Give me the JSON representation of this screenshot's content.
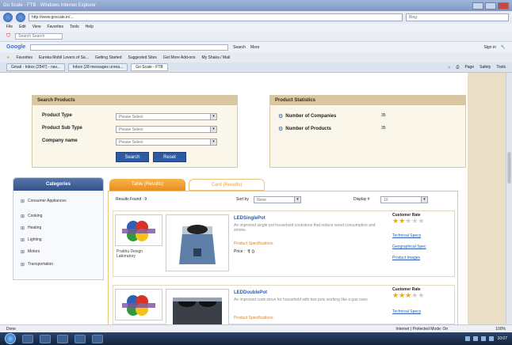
{
  "browser": {
    "title": "Go Scale - FTB - Windows Internet Explorer",
    "url": "http://www.goscale.in/...",
    "search_placeholder": "Bing",
    "menu": [
      "File",
      "Edit",
      "View",
      "Favorites",
      "Tools",
      "Help"
    ],
    "toolbar_search_placeholder": "Search Search",
    "google_label": "Google",
    "google_search_btn": "Search",
    "google_more": "More",
    "google_right": "Sign in",
    "favorites_label": "Favorites",
    "favorites": [
      "Eureka Mobil Lovers of Sa...",
      "Getting Started",
      "Suggested Sites",
      "Get More Add-ons",
      "My Shaka / Mail"
    ],
    "tabs": [
      {
        "label": "Gmail - Inbox (2547) - nav...",
        "active": false
      },
      {
        "label": "Inbox (28 messages unrea...",
        "active": false
      },
      {
        "label": "Go Scale - FTB",
        "active": true
      }
    ],
    "tab_tools": [
      "Page",
      "Safety",
      "Tools"
    ]
  },
  "search_products": {
    "header": "Search Products",
    "fields": [
      {
        "label": "Product Type",
        "value": "Please Select"
      },
      {
        "label": "Product Sub Type",
        "value": "Please Select"
      },
      {
        "label": "Company name",
        "value": "Please Select"
      }
    ],
    "search_btn": "Search",
    "reset_btn": "Reset"
  },
  "product_statistics": {
    "header": "Product Statistics",
    "rows": [
      {
        "label": "Number of Companies",
        "value": "35"
      },
      {
        "label": "Number of Products",
        "value": "35"
      }
    ]
  },
  "categories": {
    "header": "Categories",
    "items": [
      "Consumer Appliances",
      "Cooking",
      "Heating",
      "Lighting",
      "Motors",
      "Transportation"
    ]
  },
  "view_tabs": {
    "active": "Table (Results)",
    "inactive": "Card (Results)"
  },
  "results": {
    "results_found": "Results Found : 9",
    "sort_label": "Sort by",
    "sort_value": "None",
    "display_label": "Display #",
    "display_value": "10"
  },
  "products": [
    {
      "name": "LEDSinglePot",
      "company": "Prabhu Design Laboratory",
      "description": "An improved single pot household cookstove that reduce wood consumption and smoke.",
      "specs_label": "Product Specifications",
      "price_label": "Price :",
      "price_value": "₹ 0",
      "rate_label": "Customer Rate",
      "stars": 2,
      "links": [
        "Technical Specs",
        "Geographical Spec",
        "Product Images"
      ]
    },
    {
      "name": "LEDDoublePot",
      "company": "",
      "description": "An improved cook stove for household with two pots working like a gas oven",
      "specs_label": "Product Specifications",
      "price_label": "",
      "price_value": "",
      "rate_label": "Customer Rate",
      "stars": 3,
      "links": [
        "Technical Specs"
      ]
    }
  ],
  "status": {
    "text": "Done",
    "mode": "Internet | Protected Mode: On",
    "zoom": "100%"
  },
  "taskbar": {
    "clock": "10:07"
  }
}
